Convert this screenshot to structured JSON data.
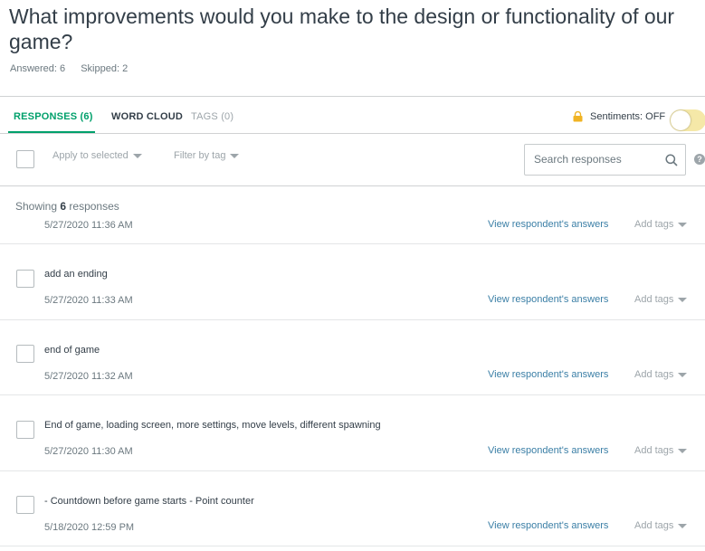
{
  "question": {
    "title": "What improvements would you make to the design or functionality of our game?",
    "answered": "Answered: 6",
    "skipped": "Skipped: 2"
  },
  "tabs": {
    "responses": "RESPONSES (6)",
    "word_cloud": "WORD CLOUD",
    "tags": "TAGS (0)"
  },
  "sentiments": {
    "label": "Sentiments: OFF",
    "enabled": false
  },
  "toolbar": {
    "apply_to_selected": "Apply to selected",
    "filter_by_tag": "Filter by tag",
    "search_placeholder": "Search responses",
    "help": "?"
  },
  "showing": {
    "prefix": "Showing ",
    "count": "6",
    "suffix": " responses"
  },
  "partial_response": {
    "date": "5/27/2020 11:36 AM",
    "view_link": "View respondent's answers",
    "add_tags": "Add tags"
  },
  "responses": [
    {
      "text": "add an ending",
      "date": "5/27/2020 11:33 AM",
      "view_link": "View respondent's answers",
      "add_tags": "Add tags"
    },
    {
      "text": "end of game",
      "date": "5/27/2020 11:32 AM",
      "view_link": "View respondent's answers",
      "add_tags": "Add tags"
    },
    {
      "text": "End of game, loading screen, more settings, move levels, different spawning",
      "date": "5/27/2020 11:30 AM",
      "view_link": "View respondent's answers",
      "add_tags": "Add tags"
    },
    {
      "text": "- Countdown before game starts - Point counter",
      "date": "5/18/2020 12:59 PM",
      "view_link": "View respondent's answers",
      "add_tags": "Add tags"
    }
  ],
  "colors": {
    "accent": "#00a06b",
    "link": "#3b7fa6",
    "toggle_off": "#f5e8a8",
    "text": "#333e48",
    "muted": "#9da5aa"
  }
}
